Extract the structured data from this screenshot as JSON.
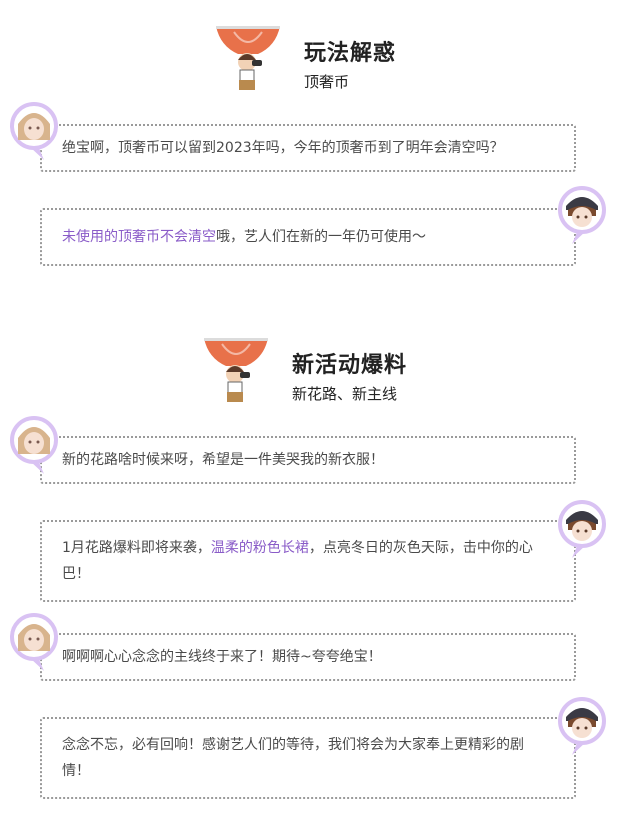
{
  "sections": [
    {
      "title": "玩法解惑",
      "subtitle": "顶奢币",
      "messages": [
        {
          "speaker": "girl",
          "text": "绝宝啊，顶奢币可以留到2023年吗，今年的顶奢币到了明年会清空吗？"
        },
        {
          "speaker": "boy",
          "highlight": "未使用的顶奢币不会清空",
          "text": "哦，艺人们在新的一年仍可使用～"
        }
      ]
    },
    {
      "title": "新活动爆料",
      "subtitle": "新花路、新主线",
      "messages": [
        {
          "speaker": "girl",
          "text": "新的花路啥时候来呀，希望是一件美哭我的新衣服！"
        },
        {
          "speaker": "boy",
          "before": "1月花路爆料即将来袭，",
          "highlight": "温柔的粉色长裙",
          "after": "，点亮冬日的灰色天际，击中你的心巴！"
        },
        {
          "speaker": "girl",
          "text": "啊啊啊心心念念的主线终于来了！期待~夸夸绝宝！"
        },
        {
          "speaker": "boy",
          "text": "念念不忘，必有回响！感谢艺人们的等待，我们将会为大家奉上更精彩的剧情！"
        }
      ]
    }
  ],
  "colors": {
    "highlight": "#8a5cc8",
    "avatar_ring": "#d9c2f3",
    "balloon": "#e8714a",
    "border": "#9a9a9a"
  },
  "icons": [
    "hot-air-balloon-icon",
    "girl-avatar-icon",
    "boy-avatar-icon"
  ]
}
